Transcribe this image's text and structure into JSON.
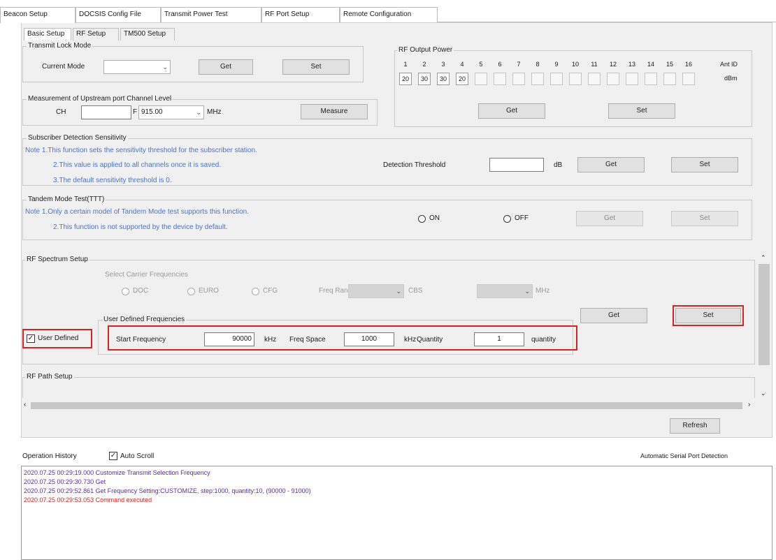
{
  "top_tabs": [
    "Beacon Setup",
    "DOCSIS Config File",
    "Transmit Power Test",
    "RF Port Setup",
    "Remote Configuration"
  ],
  "sub_tabs": [
    "Basic Setup",
    "RF Setup",
    "TM500 Setup"
  ],
  "tx_lock": {
    "title": "Transmit Lock Mode",
    "label": "Current Mode",
    "value": "",
    "get": "Get",
    "set": "Set"
  },
  "measure": {
    "title": "Measurement of Upstream port Channel Level",
    "ch_label": "CH",
    "ch_value": "",
    "freq_label": "F",
    "freq_value": "915.00",
    "unit": "MHz",
    "button": "Measure"
  },
  "rf_power": {
    "title": "RF Output Power",
    "numbers": [
      "1",
      "2",
      "3",
      "4",
      "5",
      "6",
      "7",
      "8",
      "9",
      "10",
      "11",
      "12",
      "13",
      "14",
      "15",
      "16"
    ],
    "values": [
      "20",
      "30",
      "30",
      "20",
      "",
      "",
      "",
      "",
      "",
      "",
      "",
      "",
      "",
      "",
      "",
      ""
    ],
    "ant_label": "Ant ID",
    "ant_unit": "dBm",
    "get": "Get",
    "set": "Set"
  },
  "sensitivity": {
    "title": "Subscriber Detection Sensitivity",
    "note1": "Note 1.This function sets the sensitivity threshold for the subscriber station.",
    "note2": "2.This value is applied to all channels once it is saved.",
    "note3": "3.The default sensitivity threshold is 0.",
    "threshold_label": "Detection Threshold",
    "threshold_value": "",
    "unit": "dB",
    "get": "Get",
    "set": "Set"
  },
  "tm500": {
    "title": "Tandem Mode Test(TTT)",
    "note1": "Note 1.Only a certain model of Tandem Mode test supports this function.",
    "note2": "2.This function is not supported by the device by default.",
    "on": "ON",
    "off": "OFF",
    "get": "Get",
    "set": "Set"
  },
  "rf_spectrum": {
    "title": "RF Spectrum Setup",
    "freq_header": "Select Carrier Frequencies",
    "radios": [
      "DOC",
      "EURO",
      "CFG"
    ],
    "freq_range_label": "Freq Range",
    "cbs_label": "CBS",
    "mhz": "MHz",
    "get": "Get",
    "set": "Set",
    "user_defined_check": "User Defined",
    "user_defined_group": "User Defined Frequencies",
    "start_label": "Start Frequency",
    "start_value": "90000",
    "start_unit": "kHz",
    "space_label": "Freq Space",
    "space_value": "1000",
    "space_unit": "kHz",
    "quantity_label": "Quantity",
    "quantity_value": "1",
    "quantity_unit": "quantity"
  },
  "rf_path": {
    "title": "RF Path Setup"
  },
  "refresh": "Refresh",
  "history": {
    "title": "Operation History",
    "auto_scroll": "Auto Scroll",
    "right_link": "Automatic Serial Port Detection",
    "lines": [
      {
        "text": "2020.07.25 00:29:19.000 Customize Transmit Selection Frequency",
        "color": "#5a2ca0"
      },
      {
        "text": "2020.07.25 00:29:30.730 Get",
        "color": "#5a2ca0"
      },
      {
        "text": "2020.07.25 00:29:52.861 Get Frequency Setting:CUSTOMIZE, step:1000, quantity:10, (90000 - 91000)",
        "color": "#5a2ca0"
      },
      {
        "text": "2020.07.25 00:29:53.053 Command executed",
        "color": "#e0201f"
      }
    ]
  }
}
